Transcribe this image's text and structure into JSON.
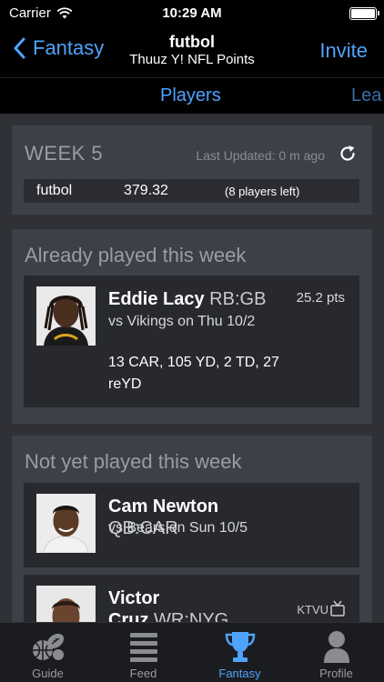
{
  "status_bar": {
    "carrier": "Carrier",
    "time": "10:29 AM"
  },
  "nav": {
    "back_label": "Fantasy",
    "title": "futbol",
    "subtitle": "Thuuz Y! NFL Points",
    "invite_label": "Invite"
  },
  "tabs": [
    {
      "label": "Players"
    },
    {
      "label": "Lea"
    }
  ],
  "week_card": {
    "week_label": "WEEK 5",
    "last_updated": "Last Updated: 0 m ago",
    "team_name": "futbol",
    "team_points": "379.32",
    "players_left": "(8 players left)"
  },
  "played_section": {
    "title": "Already played this week",
    "players": [
      {
        "name": "Eddie Lacy",
        "position": "RB:GB",
        "game": "vs Vikings on Thu 10/2",
        "stats": "13 CAR, 105 YD, 2 TD, 27 reYD",
        "points": "25.2 pts"
      }
    ]
  },
  "notyet_section": {
    "title": "Not yet played this week",
    "players": [
      {
        "name": "Cam Newton",
        "position": "QB:CAR",
        "game": "vs Bears on Sun 10/5"
      },
      {
        "name": "Victor",
        "name_line2": "Cruz",
        "position": "WR:NYG",
        "tv": "KTVU"
      }
    ]
  },
  "tabbar": [
    {
      "label": "Guide",
      "icon": "sports-balls-icon"
    },
    {
      "label": "Feed",
      "icon": "feed-list-icon"
    },
    {
      "label": "Fantasy",
      "icon": "trophy-icon",
      "active": true
    },
    {
      "label": "Profile",
      "icon": "person-icon"
    }
  ],
  "colors": {
    "accent": "#4fa3ff",
    "background": "#2f3137",
    "card": "#3d4048",
    "player_card": "#27292e"
  }
}
